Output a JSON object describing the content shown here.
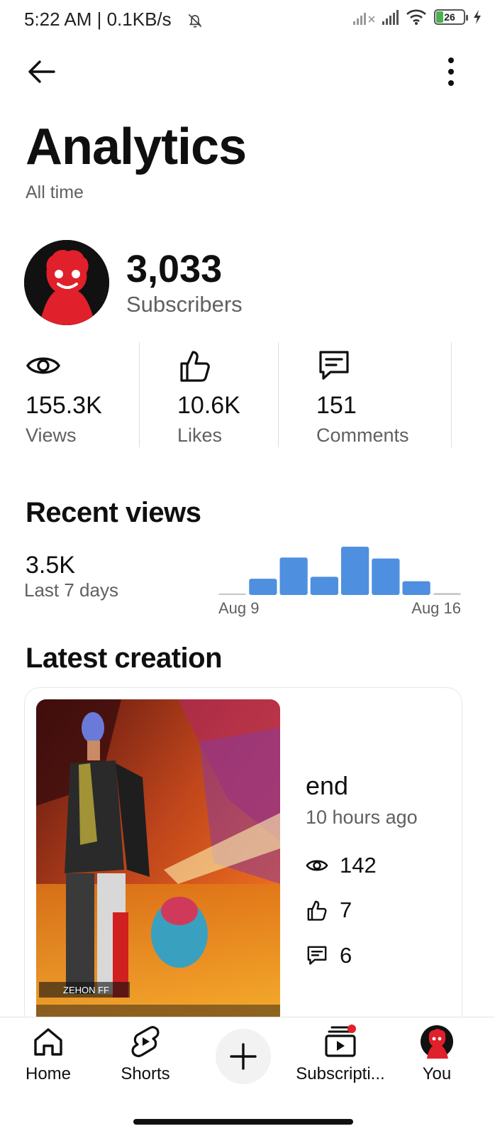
{
  "status_bar": {
    "time_text": "5:22 AM | 0.1KB/s",
    "battery_level": "26",
    "battery_color": "#4caf50"
  },
  "header": {
    "title": "Analytics",
    "subtitle": "All time"
  },
  "channel": {
    "subscriber_count": "3,033",
    "subscriber_label": "Subscribers"
  },
  "stats": [
    {
      "icon": "eye-icon",
      "value": "155.3K",
      "label": "Views"
    },
    {
      "icon": "thumbs-up-icon",
      "value": "10.6K",
      "label": "Likes"
    },
    {
      "icon": "comment-icon",
      "value": "151",
      "label": "Comments"
    }
  ],
  "recent_views": {
    "title": "Recent views",
    "value": "3.5K",
    "period_label": "Last 7 days",
    "chart_data": {
      "type": "bar",
      "categories": [
        "Aug 9",
        "Aug 10",
        "Aug 11",
        "Aug 12",
        "Aug 13",
        "Aug 14",
        "Aug 15",
        "Aug 16"
      ],
      "values": [
        30,
        330,
        760,
        370,
        980,
        740,
        280,
        40
      ],
      "x_tick_labels": [
        "Aug 9",
        "Aug 16"
      ],
      "bar_color": "#4f8fdf"
    }
  },
  "latest_creation": {
    "section_title": "Latest creation",
    "video": {
      "title": "end",
      "age": "10 hours ago",
      "views": "142",
      "likes": "7",
      "comments": "6",
      "thumbnail_caption": "ZEHON FF"
    }
  },
  "bottom_nav": {
    "home_label": "Home",
    "shorts_label": "Shorts",
    "subscriptions_label": "Subscripti...",
    "you_label": "You",
    "notification_dot_color": "#e0202a"
  },
  "colors": {
    "text_primary": "#0f0f0f",
    "text_secondary": "#606060",
    "avatar_red": "#e0202a"
  }
}
